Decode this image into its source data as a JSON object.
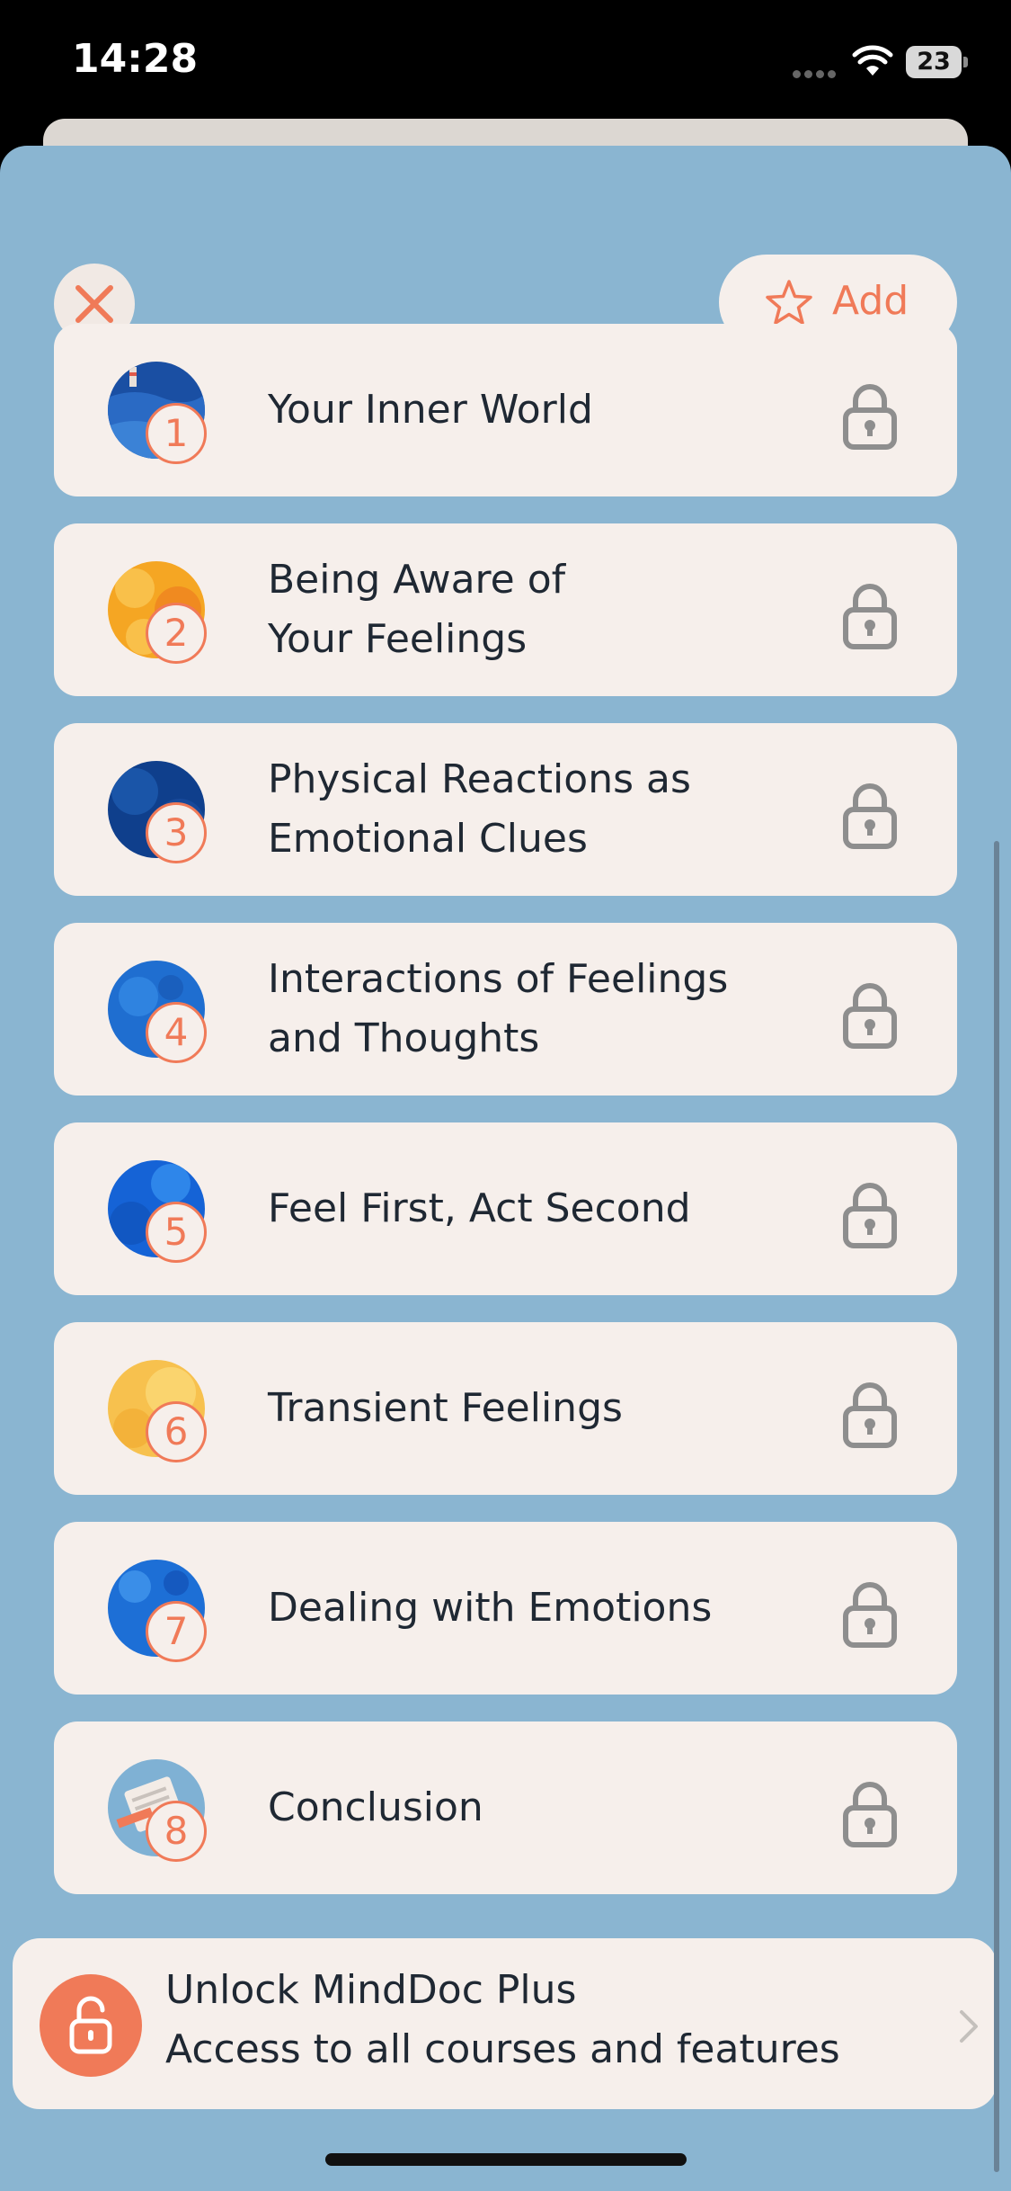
{
  "status_bar": {
    "time": "14:28",
    "battery": "23"
  },
  "header": {
    "add_label": "Add"
  },
  "courses": [
    {
      "number": "1",
      "title": "Your Inner World"
    },
    {
      "number": "2",
      "title": "Being Aware of\nYour Feelings"
    },
    {
      "number": "3",
      "title": "Physical Reactions as\nEmotional Clues"
    },
    {
      "number": "4",
      "title": "Interactions of Feelings\nand Thoughts"
    },
    {
      "number": "5",
      "title": "Feel First, Act Second"
    },
    {
      "number": "6",
      "title": "Transient Feelings"
    },
    {
      "number": "7",
      "title": "Dealing with Emotions"
    },
    {
      "number": "8",
      "title": "Conclusion"
    }
  ],
  "unlock": {
    "title": "Unlock MindDoc Plus",
    "subtitle": "Access to all courses and features"
  },
  "colors": {
    "sheet_background": "#8ab5d1",
    "card_background": "#f6efeb",
    "accent": "#f07a58",
    "lock_gray": "#8e8e8e"
  }
}
